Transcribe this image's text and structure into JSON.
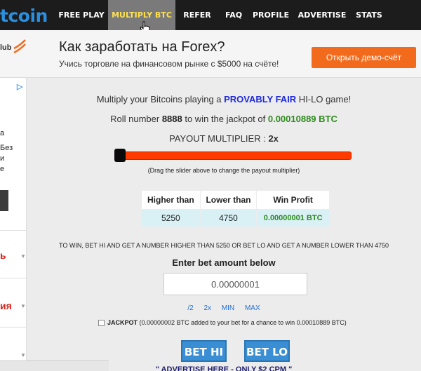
{
  "nav": {
    "logo": "tcoin",
    "items": [
      "FREE PLAY",
      "MULTIPLY BTC",
      "REFER",
      "FAQ",
      "PROFILE",
      "ADVERTISE",
      "STATS"
    ],
    "active_index": 1,
    "colors": {
      "bar": "#1c1c1c",
      "active_bg": "#7a7a7a",
      "active_text": "#ffe14d",
      "logo": "#2b8fe0"
    }
  },
  "banner": {
    "brand_fragment": "lub",
    "title": "Как заработать на Forex?",
    "subtitle": "Учись торговле на финансовом рынке с $5000 на счёте!",
    "button_label": "Открыть демо-счёт",
    "button_color": "#f26b1d"
  },
  "left_panel": {
    "adchoices_glyph": "▷",
    "text_lines": [
      "а",
      "Без",
      "и",
      "е"
    ],
    "red_items": [
      "ь",
      "ия"
    ]
  },
  "game": {
    "intro_prefix": "Multiply your Bitcoins playing a ",
    "intro_highlight": "PROVABLY FAIR",
    "intro_suffix": " HI-LO game!",
    "roll_prefix": "Roll number ",
    "roll_number": "8888",
    "roll_middle": " to win the jackpot of ",
    "jackpot_amount": "0.00010889 BTC",
    "payout_label": "PAYOUT MULTIPLIER : ",
    "payout_value": "2x",
    "slider_level": 0,
    "slider_hint": "(Drag the slider above to change the payout multiplier)",
    "table": {
      "headers": [
        "Higher than",
        "Lower than",
        "Win Profit"
      ],
      "row": [
        "5250",
        "4750",
        "0.00000001 BTC"
      ]
    },
    "rule_text": "TO WIN, BET HI AND GET A NUMBER HIGHER THAN 5250 OR BET LO AND GET A NUMBER LOWER THAN 4750",
    "bet_heading": "Enter bet amount below",
    "bet_value": "0.00000001",
    "quick_links": [
      "/2",
      "2x",
      "MIN",
      "MAX"
    ],
    "jackpot_label": "JACKPOT",
    "jackpot_text": " (0.00000002 BTC added to your bet for a chance to win 0.00010889 BTC)",
    "bet_hi_label": "BET HI",
    "bet_lo_label": "BET LO",
    "advertise_text": "\" ADVERTISE HERE - ONLY $2 CPM \""
  }
}
